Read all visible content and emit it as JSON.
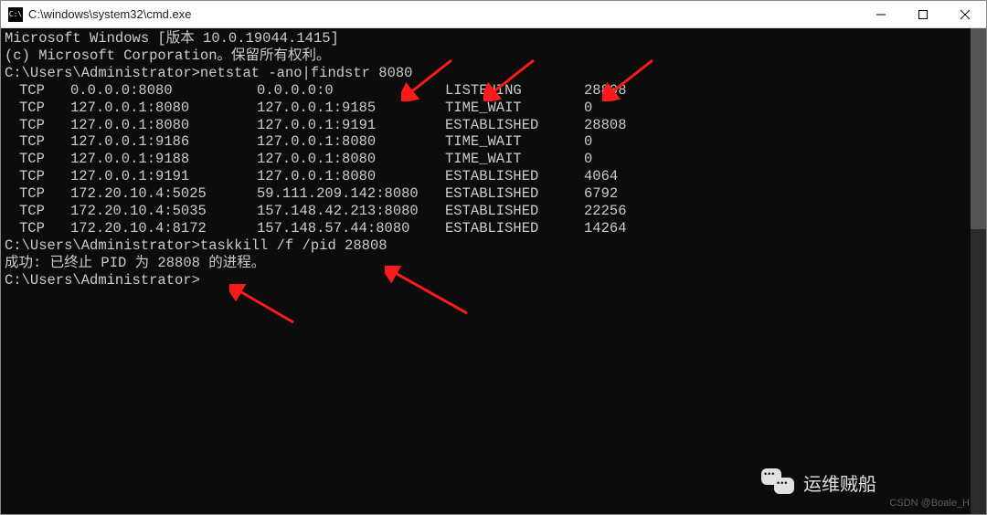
{
  "window": {
    "title": "C:\\windows\\system32\\cmd.exe",
    "icon_label": "cmd-icon"
  },
  "console": {
    "header1": "Microsoft Windows [版本 10.0.19044.1415]",
    "header2": "(c) Microsoft Corporation。保留所有权利。",
    "prompt": "C:\\Users\\Administrator>",
    "cmd1": "netstat -ano|findstr 8080",
    "rows": [
      {
        "proto": "TCP",
        "local": "0.0.0.0:8080",
        "foreign": "0.0.0.0:0",
        "state": "LISTENING",
        "pid": "28808"
      },
      {
        "proto": "TCP",
        "local": "127.0.0.1:8080",
        "foreign": "127.0.0.1:9185",
        "state": "TIME_WAIT",
        "pid": "0"
      },
      {
        "proto": "TCP",
        "local": "127.0.0.1:8080",
        "foreign": "127.0.0.1:9191",
        "state": "ESTABLISHED",
        "pid": "28808"
      },
      {
        "proto": "TCP",
        "local": "127.0.0.1:9186",
        "foreign": "127.0.0.1:8080",
        "state": "TIME_WAIT",
        "pid": "0"
      },
      {
        "proto": "TCP",
        "local": "127.0.0.1:9188",
        "foreign": "127.0.0.1:8080",
        "state": "TIME_WAIT",
        "pid": "0"
      },
      {
        "proto": "TCP",
        "local": "127.0.0.1:9191",
        "foreign": "127.0.0.1:8080",
        "state": "ESTABLISHED",
        "pid": "4064"
      },
      {
        "proto": "TCP",
        "local": "172.20.10.4:5025",
        "foreign": "59.111.209.142:8080",
        "state": "ESTABLISHED",
        "pid": "6792"
      },
      {
        "proto": "TCP",
        "local": "172.20.10.4:5035",
        "foreign": "157.148.42.213:8080",
        "state": "ESTABLISHED",
        "pid": "22256"
      },
      {
        "proto": "TCP",
        "local": "172.20.10.4:8172",
        "foreign": "157.148.57.44:8080",
        "state": "ESTABLISHED",
        "pid": "14264"
      }
    ],
    "cmd2": "taskkill /f /pid 28808",
    "result2": "成功: 已终止 PID 为 28808 的进程。",
    "prompt3": "C:\\Users\\Administrator>"
  },
  "annotations": {
    "arrow_color": "#ff0000"
  },
  "watermark": {
    "brand": "运维贼船",
    "csdn": "CSDN @Boale_H"
  }
}
